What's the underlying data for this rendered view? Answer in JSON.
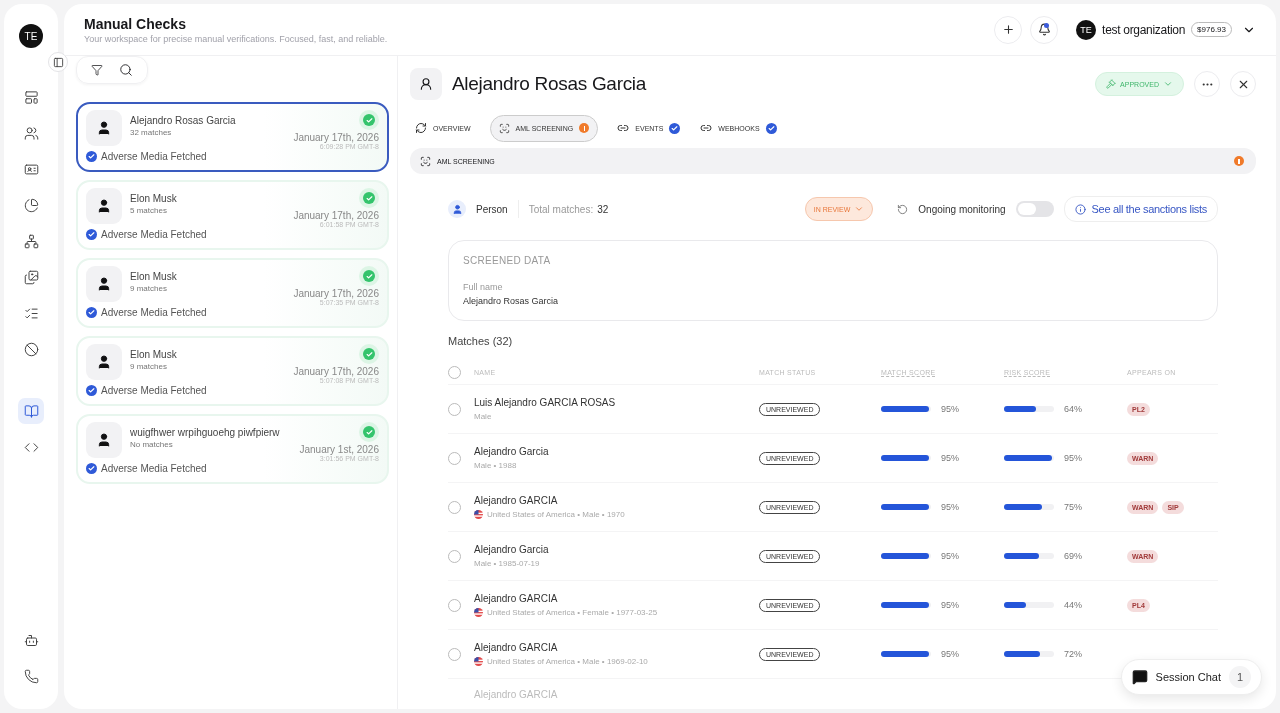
{
  "rail": {
    "avatar": "TE",
    "items": [
      {
        "selected": false
      },
      {
        "selected": false
      },
      {
        "selected": false
      },
      {
        "selected": false
      },
      {
        "selected": false
      },
      {
        "selected": false
      },
      {
        "selected": false
      },
      {
        "selected": false
      },
      {
        "selected": true
      },
      {
        "selected": false
      }
    ]
  },
  "header": {
    "title": "Manual Checks",
    "subtitle": "Your workspace for precise manual verifications. Focused, fast, and reliable.",
    "org": {
      "avatar": "TE",
      "name": "test organization",
      "balance": "$976.93"
    },
    "notification_dot": true
  },
  "checks": [
    {
      "name": "Alejandro Rosas Garcia",
      "matches": "32 matches",
      "status": "Adverse Media Fetched",
      "date": "January 17th, 2026",
      "time": "6:09:28 PM GMT-8",
      "selected": true
    },
    {
      "name": "Elon Musk",
      "matches": "5 matches",
      "status": "Adverse Media Fetched",
      "date": "January 17th, 2026",
      "time": "6:01:58 PM GMT-8",
      "selected": false
    },
    {
      "name": "Elon Musk",
      "matches": "9 matches",
      "status": "Adverse Media Fetched",
      "date": "January 17th, 2026",
      "time": "5:07:35 PM GMT-8",
      "selected": false
    },
    {
      "name": "Elon Musk",
      "matches": "9 matches",
      "status": "Adverse Media Fetched",
      "date": "January 17th, 2026",
      "time": "5:07:08 PM GMT-8",
      "selected": false
    },
    {
      "name": "wuigfhwer wrpihguoehg piwfpierw",
      "matches": "No matches",
      "status": "Adverse Media Fetched",
      "date": "January 1st, 2026",
      "time": "3:01:56 PM GMT-8",
      "selected": false
    }
  ],
  "detail": {
    "title": "Alejandro Rosas Garcia",
    "decision": "APPROVED",
    "tabs": [
      {
        "label": "OVERVIEW",
        "kind": "overview",
        "alert": false,
        "verified": false,
        "selected": false
      },
      {
        "label": "AML SCREENING",
        "kind": "aml",
        "alert": true,
        "verified": false,
        "selected": true
      },
      {
        "label": "EVENTS",
        "kind": "link",
        "alert": false,
        "verified": true,
        "selected": false
      },
      {
        "label": "WEBHOOKS",
        "kind": "link",
        "alert": false,
        "verified": true,
        "selected": false
      }
    ],
    "section": {
      "label": "AML SCREENING",
      "alert": true
    },
    "summary": {
      "entity": "Person",
      "total_label": "Total matches:",
      "total": "32",
      "review_status": "IN REVIEW",
      "monitoring_label": "Ongoing monitoring",
      "monitoring_on": false,
      "sanctions_link": "See all the sanctions lists"
    },
    "screened": {
      "heading": "SCREENED DATA",
      "field_label": "Full name",
      "field_value": "Alejandro Rosas Garcia"
    },
    "matches_title": "Matches (32)",
    "table": {
      "select_all_checked": false,
      "columns": [
        "NAME",
        "MATCH STATUS",
        "MATCH SCORE",
        "RISK SCORE",
        "APPEARS ON"
      ],
      "rows": [
        {
          "kind": "full",
          "name": "Luis Alejandro GARCIA ROSAS",
          "flag": false,
          "meta": "Male",
          "status": "UNREVIEWED",
          "match": {
            "level": 0.95,
            "text": "95%"
          },
          "risk": {
            "level": 0.64,
            "text": "64%"
          },
          "tags": [
            "PL2"
          ],
          "checked": false
        },
        {
          "kind": "full",
          "name": "Alejandro Garcia",
          "flag": false,
          "meta": "Male • 1988",
          "status": "UNREVIEWED",
          "match": {
            "level": 0.95,
            "text": "95%"
          },
          "risk": {
            "level": 0.95,
            "text": "95%"
          },
          "tags": [
            "WARN"
          ],
          "checked": false
        },
        {
          "kind": "full",
          "name": "Alejandro GARCIA",
          "flag": true,
          "meta": "United States of America • Male • 1970",
          "status": "UNREVIEWED",
          "match": {
            "level": 0.95,
            "text": "95%"
          },
          "risk": {
            "level": 0.75,
            "text": "75%"
          },
          "tags": [
            "WARN",
            "SIP"
          ],
          "checked": false
        },
        {
          "kind": "full",
          "name": "Alejandro Garcia",
          "flag": false,
          "meta": "Male • 1985-07-19",
          "status": "UNREVIEWED",
          "match": {
            "level": 0.95,
            "text": "95%"
          },
          "risk": {
            "level": 0.69,
            "text": "69%"
          },
          "tags": [
            "WARN"
          ],
          "checked": false
        },
        {
          "kind": "full",
          "name": "Alejandro GARCIA",
          "flag": true,
          "meta": "United States of America • Female • 1977-03-25",
          "status": "UNREVIEWED",
          "match": {
            "level": 0.95,
            "text": "95%"
          },
          "risk": {
            "level": 0.44,
            "text": "44%"
          },
          "tags": [
            "PL4"
          ],
          "checked": false
        },
        {
          "kind": "full",
          "name": "Alejandro GARCIA",
          "flag": true,
          "meta": "United States of America • Male • 1969-02-10",
          "status": "UNREVIEWED",
          "match": {
            "level": 0.95,
            "text": "95%"
          },
          "risk": {
            "level": 0.72,
            "text": "72%"
          },
          "checked": false
        },
        {
          "kind": "cut",
          "name": "Alejandro GARCIA"
        }
      ]
    }
  },
  "chat": {
    "label": "Session Chat",
    "count": "1"
  }
}
